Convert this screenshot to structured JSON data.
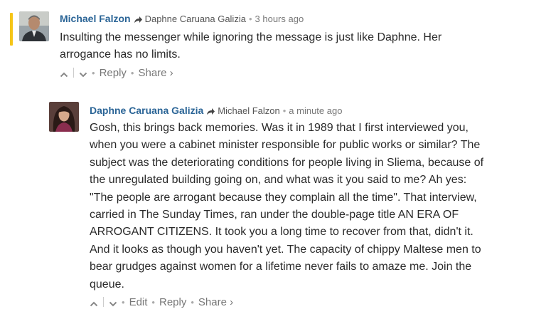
{
  "comments": [
    {
      "author": "Michael Falzon",
      "in_reply_to": "Daphne Caruana Galizia",
      "time": "3 hours ago",
      "body": "Insulting the messenger while ignoring the message is just like Daphne. Her\narrogance has no limits.",
      "actions": {
        "reply": "Reply",
        "share": "Share ›"
      }
    },
    {
      "author": "Daphne Caruana Galizia",
      "in_reply_to": "Michael Falzon",
      "time": "a minute ago",
      "body": "Gosh, this brings back memories. Was it in 1989 that I first interviewed you,\nwhen you were a cabinet minister responsible for public works or similar? The\nsubject was the deteriorating conditions for people living in Sliema, because of\nthe unregulated building going on, and what was it you said to me? Ah yes:\n\"The people are arrogant because they complain all the time\". That interview,\ncarried in The Sunday Times, ran under the double-page title AN ERA OF\nARROGANT CITIZENS. It took you a long time to recover from that, didn't it.\nAnd it looks as though you haven't yet. The capacity of chippy Maltese men to\nbear grudges against women for a lifetime never fails to amaze me. Join the\nqueue.",
      "actions": {
        "edit": "Edit",
        "reply": "Reply",
        "share": "Share ›"
      }
    }
  ],
  "separator": "•",
  "colors": {
    "author": "#2a6496",
    "new_marker": "#f5c518"
  },
  "icons": [
    "upvote-icon",
    "downvote-icon",
    "reply-arrow-icon",
    "avatar"
  ]
}
